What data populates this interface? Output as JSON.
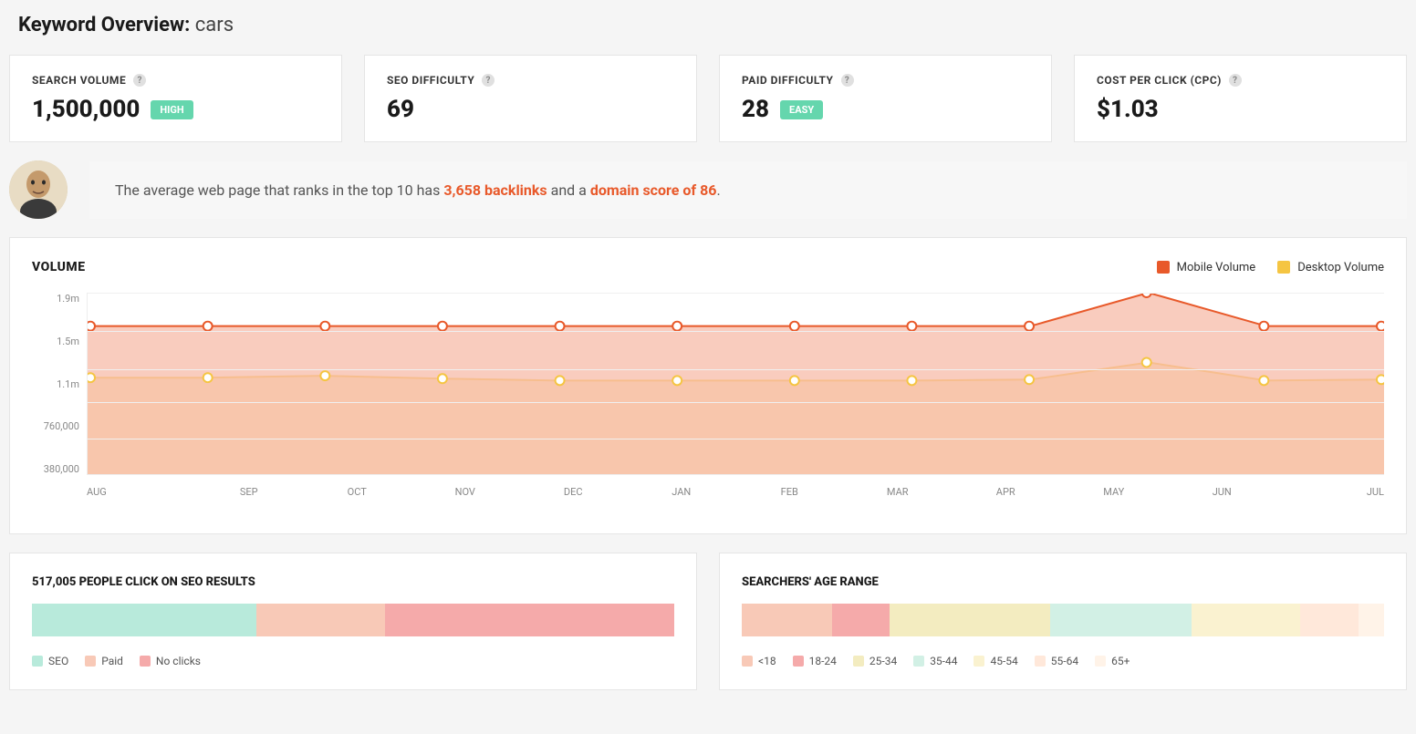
{
  "page": {
    "title_prefix": "Keyword Overview:",
    "keyword": "cars"
  },
  "cards": {
    "search_volume": {
      "label": "SEARCH VOLUME",
      "value": "1,500,000",
      "badge": "HIGH"
    },
    "seo_difficulty": {
      "label": "SEO DIFFICULTY",
      "value": "69"
    },
    "paid_difficulty": {
      "label": "PAID DIFFICULTY",
      "value": "28",
      "badge": "EASY"
    },
    "cpc": {
      "label": "COST PER CLICK (CPC)",
      "value": "$1.03"
    }
  },
  "insight": {
    "prefix": "The average web page that ranks in the top 10 has ",
    "backlinks": "3,658 backlinks",
    "middle": " and a ",
    "domain_score": "domain score of 86",
    "suffix": "."
  },
  "volume_chart": {
    "title": "VOLUME",
    "legend": {
      "mobile": {
        "label": "Mobile Volume",
        "color": "#e8592a"
      },
      "desktop": {
        "label": "Desktop Volume",
        "color": "#f5c542"
      }
    }
  },
  "chart_data": {
    "type": "area",
    "categories": [
      "AUG",
      "SEP",
      "OCT",
      "NOV",
      "DEC",
      "JAN",
      "FEB",
      "MAR",
      "APR",
      "MAY",
      "JUN",
      "JUL"
    ],
    "y_ticks": [
      "1.9m",
      "1.5m",
      "1.1m",
      "760,000",
      "380,000"
    ],
    "ylim": [
      0,
      1900000
    ],
    "series": [
      {
        "name": "Mobile Volume",
        "color": "#e8592a",
        "fill": "#f7bba8",
        "values": [
          1550000,
          1550000,
          1550000,
          1550000,
          1550000,
          1550000,
          1550000,
          1550000,
          1550000,
          1900000,
          1550000,
          1550000
        ]
      },
      {
        "name": "Desktop Volume",
        "color": "#f5c542",
        "fill": "#f9dfa1",
        "values": [
          1010000,
          1010000,
          1030000,
          1000000,
          980000,
          980000,
          980000,
          980000,
          990000,
          1170000,
          980000,
          990000
        ]
      }
    ]
  },
  "clicks_panel": {
    "title": "517,005 PEOPLE CLICK ON SEO RESULTS",
    "segments": [
      {
        "label": "SEO",
        "color": "#b8eadb",
        "pct": 35
      },
      {
        "label": "Paid",
        "color": "#f8c9b7",
        "pct": 20
      },
      {
        "label": "No clicks",
        "color": "#f5aaaa",
        "pct": 45
      }
    ]
  },
  "age_panel": {
    "title": "SEARCHERS' AGE RANGE",
    "segments": [
      {
        "label": "<18",
        "color": "#f8c9b7",
        "pct": 14
      },
      {
        "label": "18-24",
        "color": "#f5aaaa",
        "pct": 9
      },
      {
        "label": "25-34",
        "color": "#f3ecc0",
        "pct": 25
      },
      {
        "label": "35-44",
        "color": "#d2f0e5",
        "pct": 22
      },
      {
        "label": "45-54",
        "color": "#faf2d0",
        "pct": 17
      },
      {
        "label": "55-64",
        "color": "#ffe8da",
        "pct": 9
      },
      {
        "label": "65+",
        "color": "#fff3e8",
        "pct": 4
      }
    ]
  }
}
